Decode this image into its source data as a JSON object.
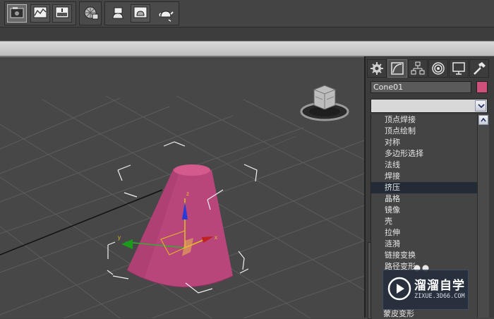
{
  "toolbar": {
    "buttons": [
      {
        "icon": "render-setup-icon",
        "active": true
      },
      {
        "icon": "curve-editor-icon",
        "active": false
      },
      {
        "icon": "rendered-frame-window-icon",
        "active": false
      },
      {
        "icon": "material-editor-icon",
        "active": false
      },
      {
        "icon": "render-production-icon",
        "active": false
      },
      {
        "icon": "render-iterative-icon",
        "active": false
      },
      {
        "icon": "render-teapot-icon",
        "active": false
      }
    ]
  },
  "command_panel": {
    "tabs": [
      {
        "icon": "create-icon"
      },
      {
        "icon": "modify-icon",
        "active": true
      },
      {
        "icon": "hierarchy-icon"
      },
      {
        "icon": "motion-icon"
      },
      {
        "icon": "display-icon"
      },
      {
        "icon": "utilities-hammer-icon"
      }
    ],
    "object_name": "Cone01",
    "object_color": "#d0507c",
    "modifier_list": {
      "current_value": "",
      "items": [
        "顶点焊接",
        "顶点绘制",
        "对称",
        "多边形选择",
        "法线",
        "焊接",
        "挤压",
        "晶格",
        "镜像",
        "壳",
        "拉伸",
        "涟漪",
        "链接变换",
        "路径变形"
      ],
      "selected_index": 6,
      "hidden_tail_item": "蒙皮变形"
    }
  },
  "viewport": {
    "object": "cone",
    "object_color": "#b8467a",
    "gizmo_axes": [
      "x",
      "y",
      "z"
    ]
  },
  "watermark": {
    "title": "溜溜自学",
    "url": "ZIXUE.3D66.COM"
  }
}
